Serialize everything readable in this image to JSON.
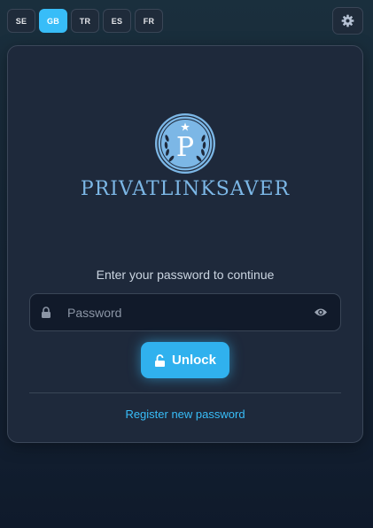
{
  "languages": [
    {
      "code": "SE",
      "active": false
    },
    {
      "code": "GB",
      "active": true
    },
    {
      "code": "TR",
      "active": false
    },
    {
      "code": "ES",
      "active": false
    },
    {
      "code": "FR",
      "active": false
    }
  ],
  "settings": {
    "icon": "gear-icon"
  },
  "logo": {
    "letter": "P",
    "brand_name": "PRIVATLINKSAVER"
  },
  "login": {
    "prompt": "Enter your password to continue",
    "password_placeholder": "Password",
    "password_value": "",
    "lock_icon": "lock-icon",
    "visibility_icon": "eye-icon",
    "unlock_label": "Unlock",
    "unlock_icon": "unlock-icon",
    "register_link": "Register new password"
  },
  "colors": {
    "accent": "#38bdf8",
    "card_bg": "#1e293b",
    "brand": "#7cb7e6"
  }
}
